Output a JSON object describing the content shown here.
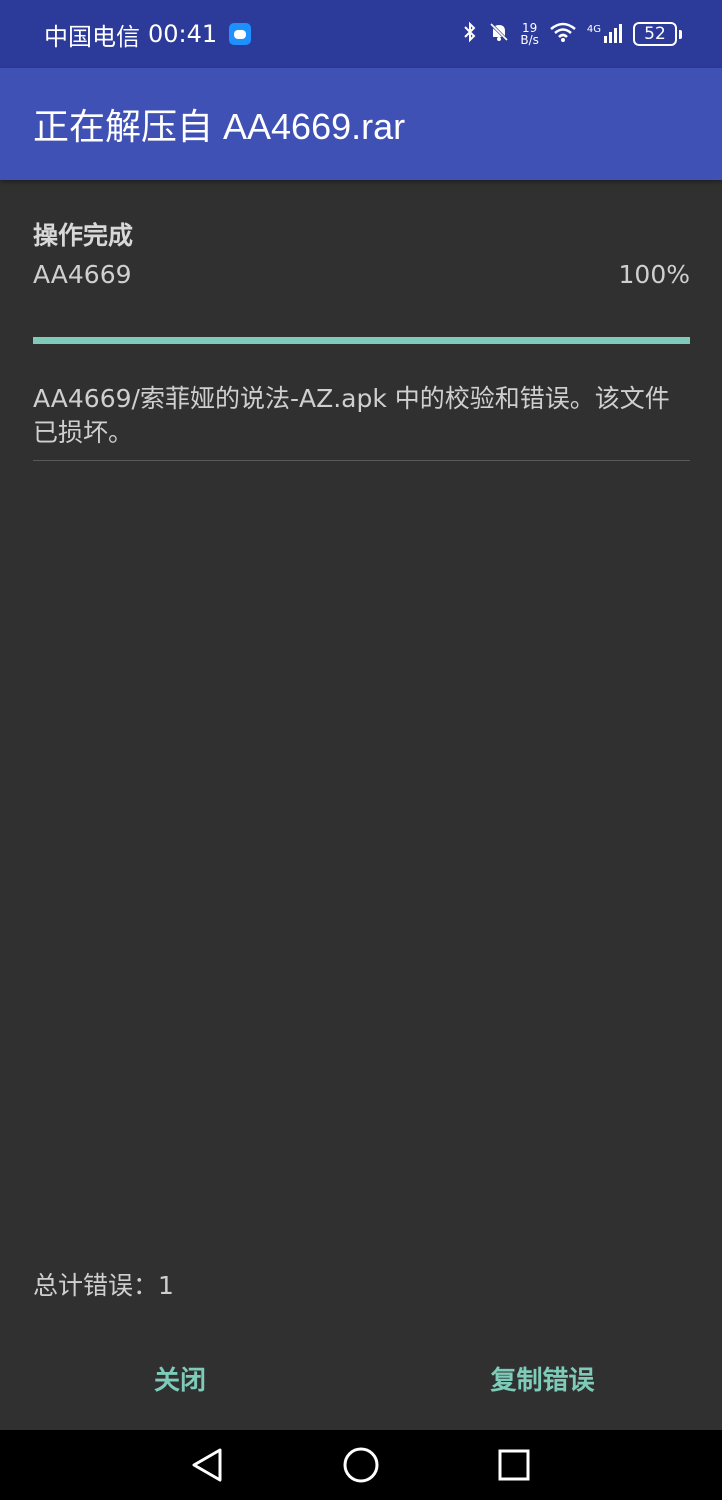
{
  "status_bar": {
    "carrier": "中国电信",
    "time": "00:41",
    "net_speed_value": "19",
    "net_speed_unit": "B/s",
    "signal_label": "4G",
    "battery": "52"
  },
  "app_bar": {
    "title": "正在解压自 AA4669.rar"
  },
  "main": {
    "status_title": "操作完成",
    "file_name": "AA4669",
    "percent": "100%",
    "progress_fraction": 1.0,
    "error_message": "AA4669/索菲娅的说法-AZ.apk 中的校验和错误。该文件已损坏。",
    "total_errors": "总计错误：1"
  },
  "buttons": {
    "close_label": "关闭",
    "copy_label": "复制错误"
  },
  "nav": {
    "icons": [
      "back-icon",
      "home-icon",
      "recents-icon"
    ]
  },
  "colors": {
    "status_bar": "#2c3a99",
    "app_bar": "#3f51b5",
    "accent": "#7ecbb9",
    "background": "#303030"
  }
}
